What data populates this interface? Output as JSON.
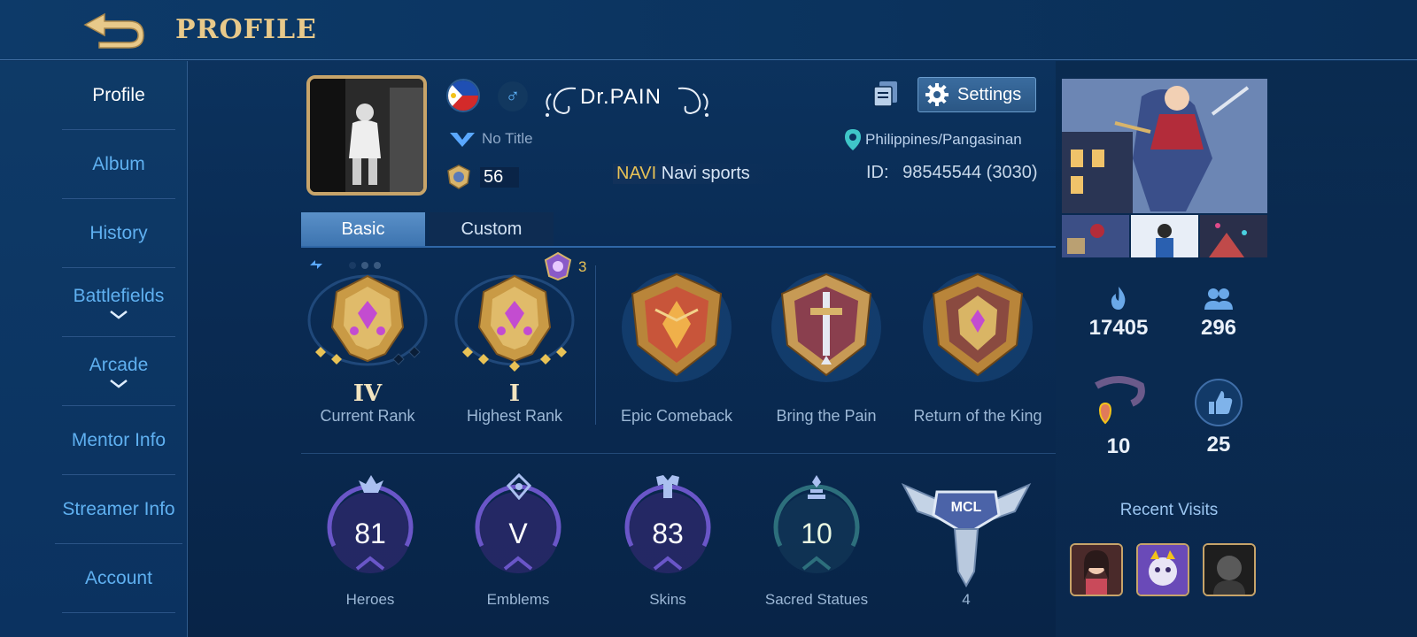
{
  "header": {
    "title": "PROFILE",
    "back_icon": "back-arrow-icon"
  },
  "sidebar": {
    "items": [
      {
        "label": "Profile",
        "active": true
      },
      {
        "label": "Album"
      },
      {
        "label": "History"
      },
      {
        "label": "Battlefields",
        "expandable": true
      },
      {
        "label": "Arcade",
        "expandable": true
      },
      {
        "label": "Mentor Info"
      },
      {
        "label": "Streamer Info"
      },
      {
        "label": "Account"
      }
    ]
  },
  "profile": {
    "name": "Dr.PAIN",
    "gender_symbol": "♂",
    "title": "No Title",
    "level": "56",
    "squad_tag": "NAVI",
    "squad_name": "Navi sports",
    "location": "Philippines/Pangasinan",
    "id_label": "ID:",
    "id_value": "98545544 (3030)",
    "settings_label": "Settings"
  },
  "tabs": [
    {
      "label": "Basic",
      "active": true
    },
    {
      "label": "Custom"
    }
  ],
  "ranks": {
    "mythic_points": "3",
    "current": {
      "label": "Current Rank",
      "tier": "IV"
    },
    "highest": {
      "label": "Highest Rank",
      "tier": "I"
    },
    "achievements": [
      {
        "label": "Epic Comeback"
      },
      {
        "label": "Bring the Pain"
      },
      {
        "label": "Return of the King"
      }
    ]
  },
  "stats": [
    {
      "label": "Heroes",
      "value": "81"
    },
    {
      "label": "Emblems",
      "value": "V"
    },
    {
      "label": "Skins",
      "value": "83"
    },
    {
      "label": "Sacred Statues",
      "value": "10"
    }
  ],
  "mcl": {
    "badge_text": "MCL",
    "count": "4"
  },
  "right": {
    "popularity": "17405",
    "followers": "296",
    "charm": "10",
    "likes": "25",
    "recent_visits_label": "Recent Visits"
  },
  "colors": {
    "accent_gold": "#e8c98a",
    "link_blue": "#5fb0f0",
    "squad_gold": "#e8c256"
  }
}
